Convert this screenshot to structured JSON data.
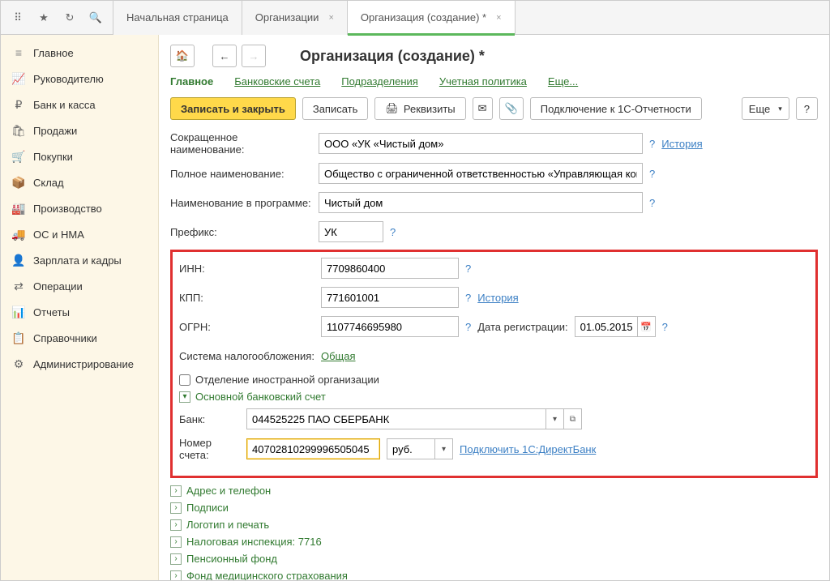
{
  "tabs": {
    "home": "Начальная страница",
    "orgs": "Организации",
    "org_create": "Организация (создание) *"
  },
  "sidebar": {
    "items": [
      {
        "label": "Главное",
        "icon": "≡"
      },
      {
        "label": "Руководителю",
        "icon": "📈"
      },
      {
        "label": "Банк и касса",
        "icon": "₽"
      },
      {
        "label": "Продажи",
        "icon": "🛍"
      },
      {
        "label": "Покупки",
        "icon": "🛒"
      },
      {
        "label": "Склад",
        "icon": "📦"
      },
      {
        "label": "Производство",
        "icon": "🏭"
      },
      {
        "label": "ОС и НМА",
        "icon": "🚚"
      },
      {
        "label": "Зарплата и кадры",
        "icon": "👤"
      },
      {
        "label": "Операции",
        "icon": "⇄"
      },
      {
        "label": "Отчеты",
        "icon": "📊"
      },
      {
        "label": "Справочники",
        "icon": "📋"
      },
      {
        "label": "Администрирование",
        "icon": "⚙"
      }
    ]
  },
  "page": {
    "title": "Организация (создание) *"
  },
  "subnav": {
    "main": "Главное",
    "bank": "Банковские счета",
    "dept": "Подразделения",
    "policy": "Учетная политика",
    "more": "Еще..."
  },
  "toolbar": {
    "save_close": "Записать и закрыть",
    "save": "Записать",
    "reqs": "Реквизиты",
    "connect": "Подключение к 1С-Отчетности",
    "more": "Еще",
    "help": "?"
  },
  "form": {
    "short_name_lbl": "Сокращенное наименование:",
    "short_name": "ООО «УК «Чистый дом»",
    "history": "История",
    "full_name_lbl": "Полное наименование:",
    "full_name": "Общество с ограниченной ответственностью «Управляющая компа",
    "prog_name_lbl": "Наименование в программе:",
    "prog_name": "Чистый дом",
    "prefix_lbl": "Префикс:",
    "prefix": "УК",
    "inn_lbl": "ИНН:",
    "inn": "7709860400",
    "kpp_lbl": "КПП:",
    "kpp": "771601001",
    "ogrn_lbl": "ОГРН:",
    "ogrn": "1107746695980",
    "reg_date_lbl": "Дата регистрации:",
    "reg_date": "01.05.2015",
    "tax_sys_lbl": "Система налогообложения:",
    "tax_sys": "Общая",
    "foreign_lbl": "Отделение иностранной организации",
    "main_bank": "Основной банковский счет",
    "bank_lbl": "Банк:",
    "bank": "044525225 ПАО СБЕРБАНК",
    "acct_lbl": "Номер счета:",
    "acct": "40702810299996505045",
    "currency": "руб.",
    "direct_bank": "Подключить 1С:ДиректБанк",
    "help": "?"
  },
  "expanders": {
    "addr": "Адрес и телефон",
    "sign": "Подписи",
    "logo": "Логотип и печать",
    "tax": "Налоговая инспекция: 7716",
    "pension": "Пенсионный фонд",
    "med": "Фонд медицинского страхования"
  }
}
